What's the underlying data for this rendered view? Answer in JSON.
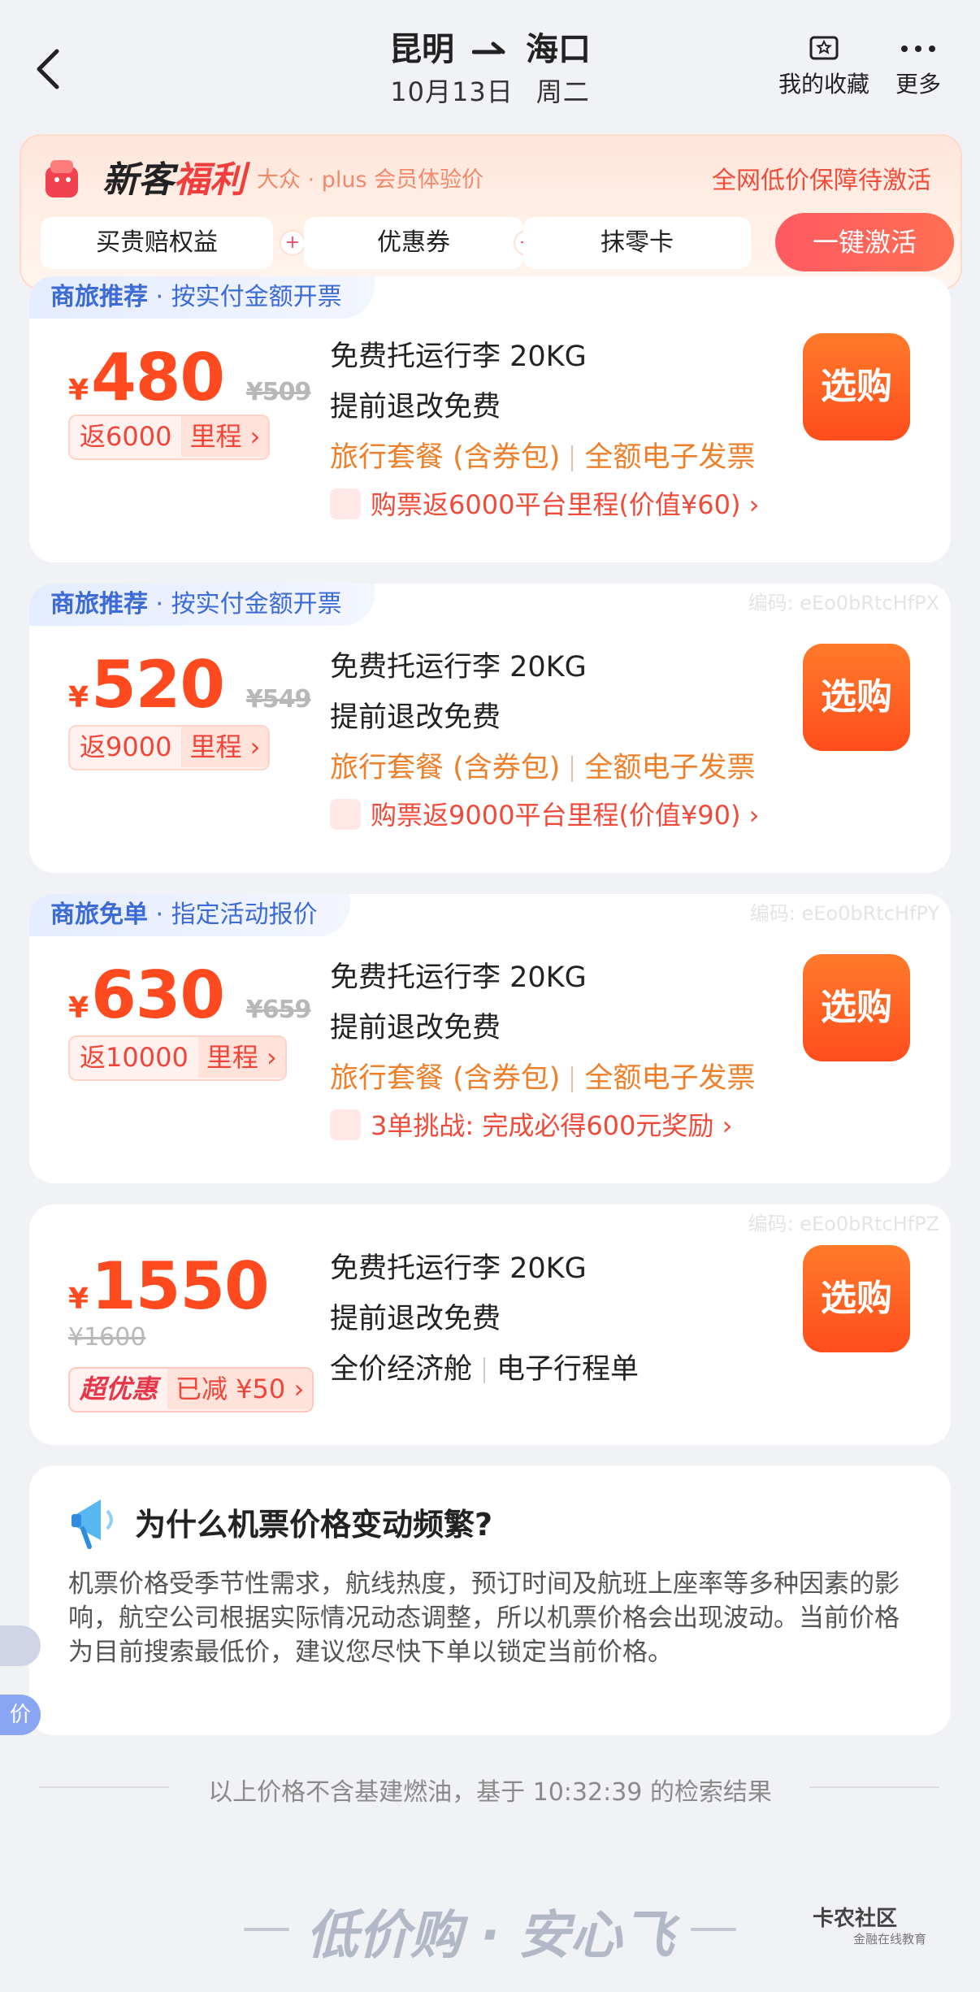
{
  "header": {
    "from": "昆明",
    "to": "海口",
    "date": "10月13日",
    "weekday": "周二",
    "favorites_label": "我的收藏",
    "more_label": "更多"
  },
  "promo": {
    "title_a": "新客",
    "title_b": "福利",
    "subtitle": "大众 · plus 会员体验价",
    "right_text": "全网低价保障待激活",
    "chips": [
      "买贵赔权益",
      "优惠券",
      "抹零卡"
    ],
    "activate_label": "一键激活"
  },
  "cards": [
    {
      "tag_bold": "商旅推荐",
      "tag_text": " · 按实付金额开票",
      "code": "",
      "price": "480",
      "original": "¥509",
      "mileage_left": "返6000",
      "mileage_right": "里程 ›",
      "line1": "免费托运行李 20KG",
      "line2": "提前退改免费",
      "line3a": "旅行套餐 (含券包)",
      "line3b": "全额电子发票",
      "gift": "购票返6000平台里程(价值¥60) ›",
      "buy": "选购"
    },
    {
      "tag_bold": "商旅推荐",
      "tag_text": " · 按实付金额开票",
      "code": "编码: eEo0bRtcHfPX",
      "price": "520",
      "original": "¥549",
      "mileage_left": "返9000",
      "mileage_right": "里程 ›",
      "line1": "免费托运行李 20KG",
      "line2": "提前退改免费",
      "line3a": "旅行套餐 (含券包)",
      "line3b": "全额电子发票",
      "gift": "购票返9000平台里程(价值¥90) ›",
      "buy": "选购"
    },
    {
      "tag_bold": "商旅免单",
      "tag_text": " · 指定活动报价",
      "code": "编码: eEo0bRtcHfPY",
      "price": "630",
      "original": "¥659",
      "mileage_left": "返10000",
      "mileage_right": "里程 ›",
      "line1": "免费托运行李 20KG",
      "line2": "提前退改免费",
      "line3a": "旅行套餐 (含券包)",
      "line3b": "全额电子发票",
      "gift": "3单挑战: 完成必得600元奖励 ›",
      "buy": "选购"
    },
    {
      "code": "编码: eEo0bRtcHfPZ",
      "price": "1550",
      "original": "¥1600",
      "badge_left": "超优惠",
      "badge_right": "已减 ¥50 ›",
      "line1": "免费托运行李 20KG",
      "line2": "提前退改免费",
      "line3a": "全价经济舱",
      "line3b": "电子行程单",
      "buy": "选购"
    }
  ],
  "faq": {
    "title": "为什么机票价格变动频繁?",
    "body": "机票价格受季节性需求，航线热度，预订时间及航班上座率等多种因素的影响，航空公司根据实际情况动态调整，所以机票价格会出现波动。当前价格为目前搜索最低价，建议您尽快下单以锁定当前价格。"
  },
  "footnote": "以上价格不含基建燃油，基于 10:32:39 的检索结果",
  "slogan": "低价购 · 安心飞",
  "watermark": {
    "name": "卡农社区",
    "sub": "金融在线教育"
  },
  "floating_label": "价",
  "colors": {
    "accent": "#ff4a1f",
    "blue_tag": "#3d6bd6",
    "orange_text": "#ee7f2b",
    "page_bg": "#f1f2f6"
  }
}
